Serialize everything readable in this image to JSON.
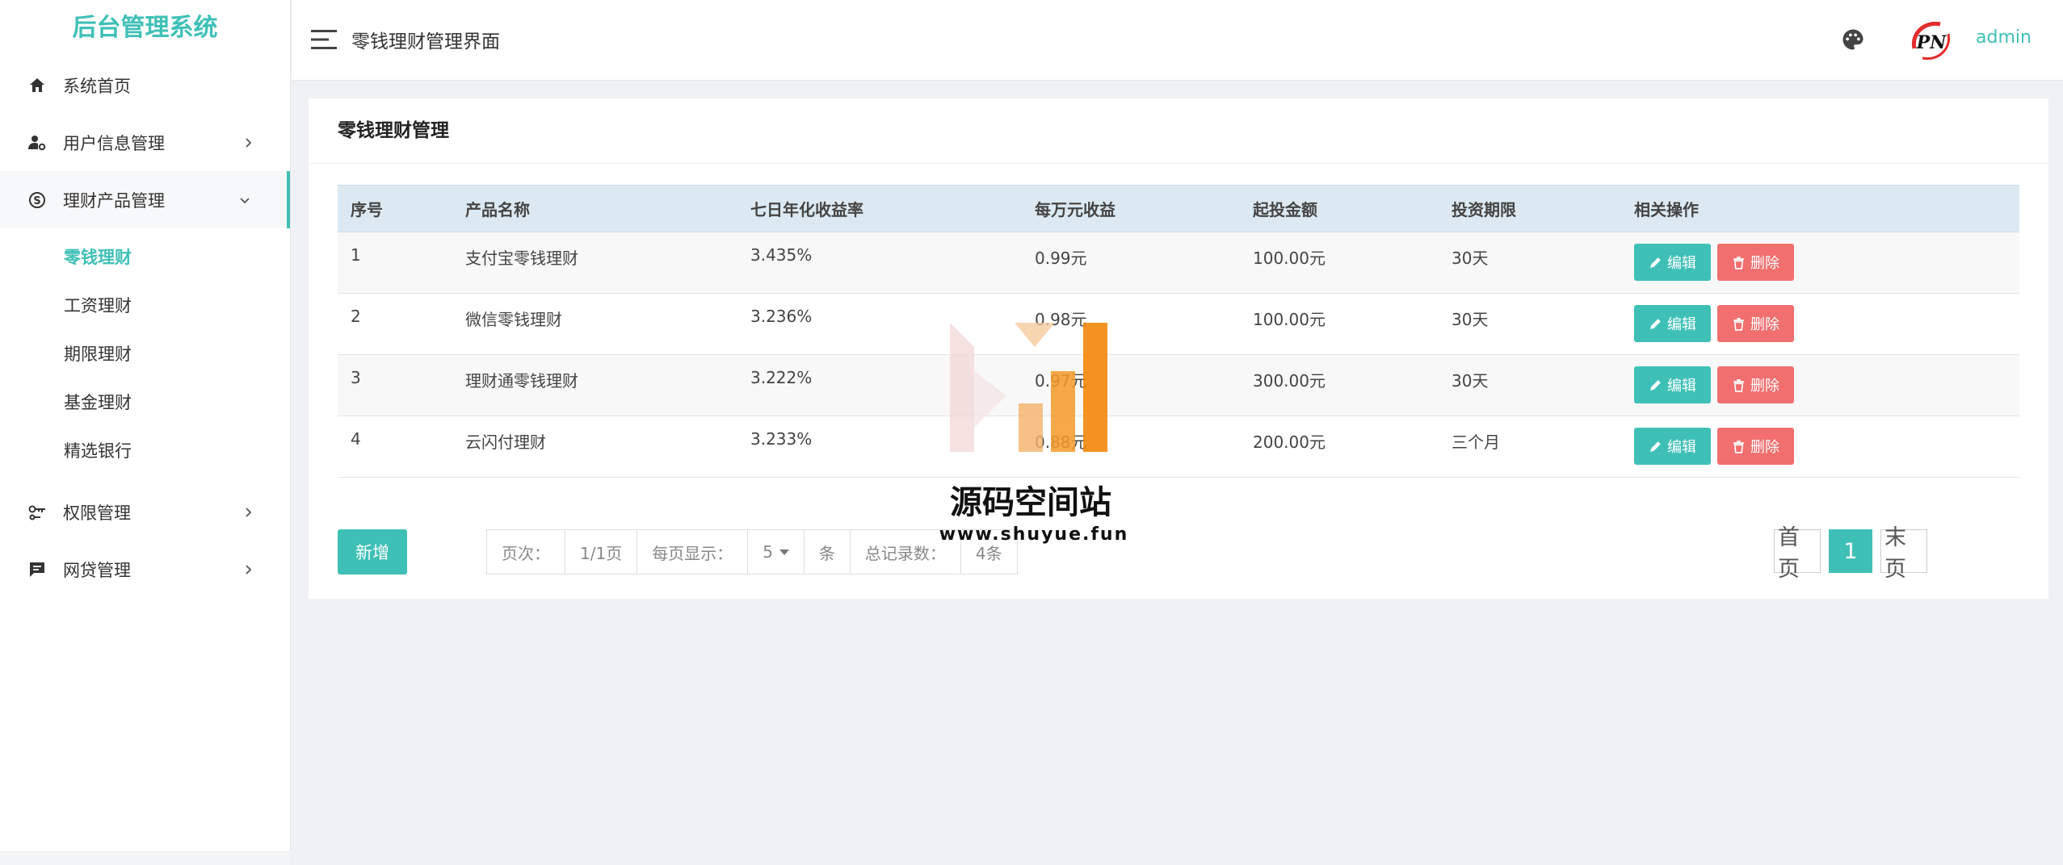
{
  "sidebar": {
    "logo": "后台管理系统",
    "items": [
      {
        "label": "系统首页"
      },
      {
        "label": "用户信息管理"
      },
      {
        "label": "理财产品管理"
      },
      {
        "label": "权限管理"
      },
      {
        "label": "网贷管理"
      }
    ],
    "submenu": [
      {
        "label": "零钱理财"
      },
      {
        "label": "工资理财"
      },
      {
        "label": "期限理财"
      },
      {
        "label": "基金理财"
      },
      {
        "label": "精选银行"
      }
    ]
  },
  "header": {
    "title": "零钱理财管理界面",
    "user": "admin"
  },
  "panel": {
    "title": "零钱理财管理"
  },
  "table": {
    "headers": [
      "序号",
      "产品名称",
      "七日年化收益率",
      "每万元收益",
      "起投金额",
      "投资期限",
      "相关操作"
    ],
    "rows": [
      [
        "1",
        "支付宝零钱理财",
        "3.435%",
        "0.99元",
        "100.00元",
        "30天"
      ],
      [
        "2",
        "微信零钱理财",
        "3.236%",
        "0.98元",
        "100.00元",
        "30天"
      ],
      [
        "3",
        "理财通零钱理财",
        "3.222%",
        "0.97元",
        "300.00元",
        "30天"
      ],
      [
        "4",
        "云闪付理财",
        "3.233%",
        "0.88元",
        "200.00元",
        "三个月"
      ]
    ],
    "edit_label": "编辑",
    "delete_label": "删除"
  },
  "footer": {
    "add_label": "新增",
    "page_label": "页次：",
    "page_value": "1/1页",
    "per_page_label": "每页显示：",
    "per_page_value": "5",
    "per_page_unit": "条",
    "total_label": "总记录数：",
    "total_value": "4条"
  },
  "pager": {
    "first": "首页",
    "current": "1",
    "last": "末页"
  },
  "watermark": {
    "title": "源码空间站",
    "url": "www.shuyue.fun"
  },
  "colors": {
    "accent": "#3fc0b7",
    "danger": "#f16f6f",
    "header_row": "#dce9f3"
  }
}
